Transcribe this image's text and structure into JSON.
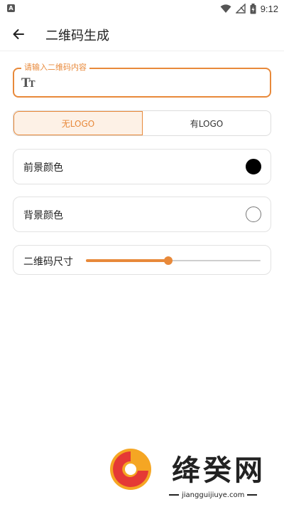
{
  "status_bar": {
    "app_icon_text": "A",
    "time": "9:12",
    "icons": [
      "wifi-icon",
      "no-signal-icon",
      "battery-icon"
    ]
  },
  "app_bar": {
    "back_icon": "arrow-left-icon",
    "title": "二维码生成"
  },
  "content_input": {
    "label": "请输入二维码内容",
    "value": "",
    "icon": "text-size-icon"
  },
  "logo_toggle": {
    "options": [
      {
        "label": "无LOGO",
        "selected": true
      },
      {
        "label": "有LOGO",
        "selected": false
      }
    ]
  },
  "foreground_color": {
    "label": "前景颜色",
    "color": "#000000"
  },
  "background_color": {
    "label": "背景颜色",
    "color": "#ffffff"
  },
  "qr_size": {
    "label": "二维码尺寸",
    "value_fraction": 0.47
  },
  "theme": {
    "accent": "#e8893a",
    "accent_light": "#fdf1e6"
  },
  "watermark": {
    "brand": "绛癸网",
    "url": "jiangguijiuye.com",
    "logo_colors": [
      "#f5a623",
      "#e53935"
    ]
  }
}
